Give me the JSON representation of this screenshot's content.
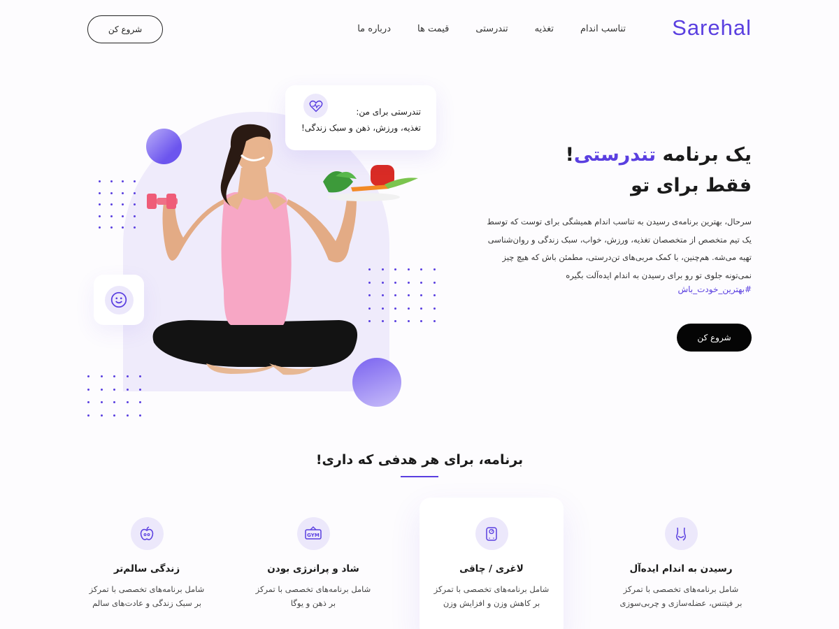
{
  "header": {
    "logo": "Sarehal",
    "nav": [
      "تناسب اندام",
      "تغذیه",
      "تندرستی",
      "قیمت ها",
      "درباره ما"
    ],
    "cta": "شروع کن"
  },
  "hero": {
    "title_part1": "یک برنامه ",
    "title_accent": "تندرستی",
    "title_part2": "!",
    "title_line2": "فقط برای تو",
    "description": "سرحال، بهترین برنامه‌ی رسیدن به تناسب اندام همیشگی برای توست که توسط یک تیم متخصص از متخصصان تغذیه، ورزش، خواب، سبک زندگی و روان‌شناسی تهیه می‌شه. هم‌چنین، با کمک مربی‌های  تن‌درستی، مطمئن باش که هیچ چیز نمی‌تونه جلوی تو رو برای رسیدن به اندام ایده‌آلت بگیره",
    "hashtag": "#بهترین_خودت_باش",
    "cta": "شروع کن"
  },
  "health_card": {
    "line1": "تندرستی برای من:",
    "line2": "تغذیه، ورزش، ذهن و سبک زندگی!",
    "icon": "heart-pulse-icon"
  },
  "smile_card": {
    "icon": "smile-icon"
  },
  "programs": {
    "title": "برنامه، برای هر هدفی که داری!",
    "items": [
      {
        "title": "رسیدن به اندام ایده‌آل",
        "desc_line1": "شامل برنامه‌های تخصصی با تمرکز",
        "desc_line2": "بر فیتنس، عضله‌سازی و چربی‌سوزی",
        "icon": "body-shape-icon"
      },
      {
        "title": "لاغری / چاقی",
        "desc_line1": "شامل برنامه‌های تخصصی با تمرکز",
        "desc_line2": "بر کاهش وزن و افزایش وزن",
        "icon": "scale-icon"
      },
      {
        "title": "شاد و پرانرژی بودن",
        "desc_line1": "شامل برنامه‌های تخصصی با تمرکز",
        "desc_line2": "بر ذهن و یوگا",
        "icon": "gym-sign-icon"
      },
      {
        "title": "زندگی سالم‌تر",
        "desc_line1": "شامل برنامه‌های تخصصی با تمرکز",
        "desc_line2": "بر سبک زندگی و عادت‌های سالم",
        "icon": "apple-icon"
      }
    ]
  },
  "colors": {
    "accent": "#5a3fe0",
    "accent_light": "#ece8fb",
    "arch": "#efebfb",
    "dark": "#050505"
  }
}
